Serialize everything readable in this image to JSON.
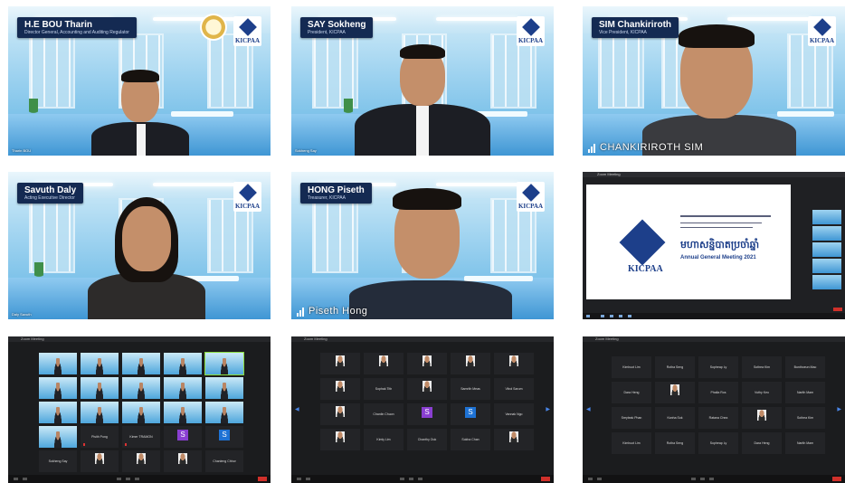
{
  "tiles": {
    "t1": {
      "name": "H.E BOU Tharin",
      "role": "Director General, Accounting and Auditing Regulator",
      "caption": "Tharin BOU"
    },
    "t2": {
      "name": "SAY Sokheng",
      "role": "President, KICPAA",
      "caption": "Sokheng Say"
    },
    "t3": {
      "name": "SIM Chankiriroth",
      "role": "Vice President, KICPAA",
      "caption": "CHANKIRIROTH SIM"
    },
    "t4": {
      "name": "Savuth Daly",
      "role": "Acting Executive Director",
      "caption": "Daly Savuth"
    },
    "t5": {
      "name": "HONG Piseth",
      "role": "Treasurer, KICPAA",
      "caption": "Piseth Hong"
    }
  },
  "logo_text": "KICPAA",
  "share": {
    "window_title": "Zoom Meeting",
    "slide_khmer": "មហាសន្និបាតប្រចាំឆ្នាំ",
    "slide_title": "Annual General Meeting 2021"
  },
  "gallery1": {
    "title": "Zoom Meeting",
    "names": [
      "Pisith Pong",
      "Kimer TRAMON",
      "Sokheng Say",
      "Piseth Hong",
      "Chanleng Chhor",
      "Daly Savuth",
      "Tharin BOU"
    ],
    "avatars": [
      "S",
      "S"
    ]
  },
  "gallery2": {
    "title": "Zoom Meeting",
    "names": [
      "Sophak Tith",
      "Samrith Meas",
      "Vibol Sarum",
      "Chanlin Chuon",
      "Vannak Ngo",
      "Kimly Lim",
      "Chanthy Ouk",
      "Sokha Chan"
    ],
    "avatars": [
      "S",
      "S"
    ]
  },
  "gallery3": {
    "title": "Zoom Meeting",
    "names": [
      "Kimhuot Lim",
      "Rotha Seng",
      "Sopheap Ly",
      "Sothea Kim",
      "Bunthoeun Mao",
      "Dara Heng",
      "Phalla Ros",
      "Vuthy Keo",
      "Narith Mam",
      "Sreyleak Phan",
      "Kanha Sok",
      "Ratana Chea"
    ]
  }
}
